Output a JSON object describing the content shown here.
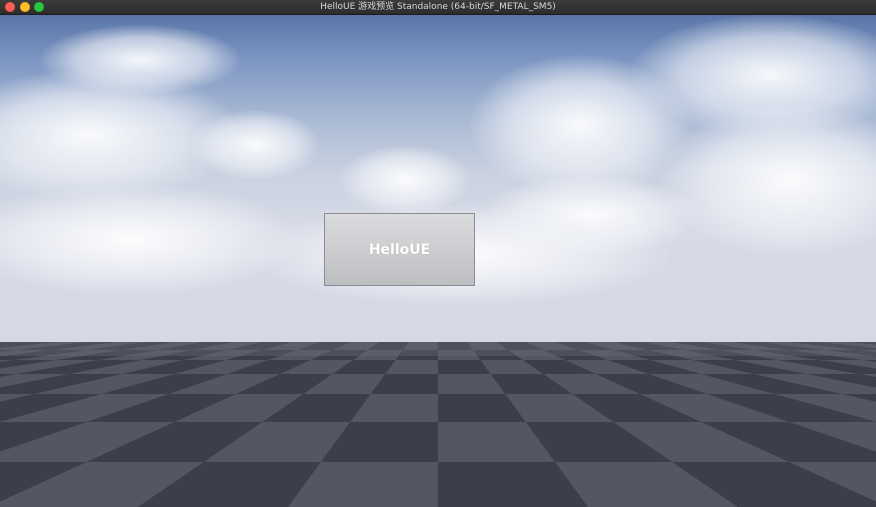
{
  "window": {
    "title": "HelloUE 游戏预览 Standalone (64-bit/SF_METAL_SM5)",
    "controls": [
      "close-icon",
      "minimize-icon",
      "maximize-icon"
    ]
  },
  "game": {
    "button_label": "HelloUE"
  },
  "colors": {
    "sky_top": "#5a76a8",
    "horizon": "#d6d8e5",
    "floor_dark": "#3c3f4b",
    "floor_light": "#545865",
    "button_face": "#cfcfd2"
  }
}
